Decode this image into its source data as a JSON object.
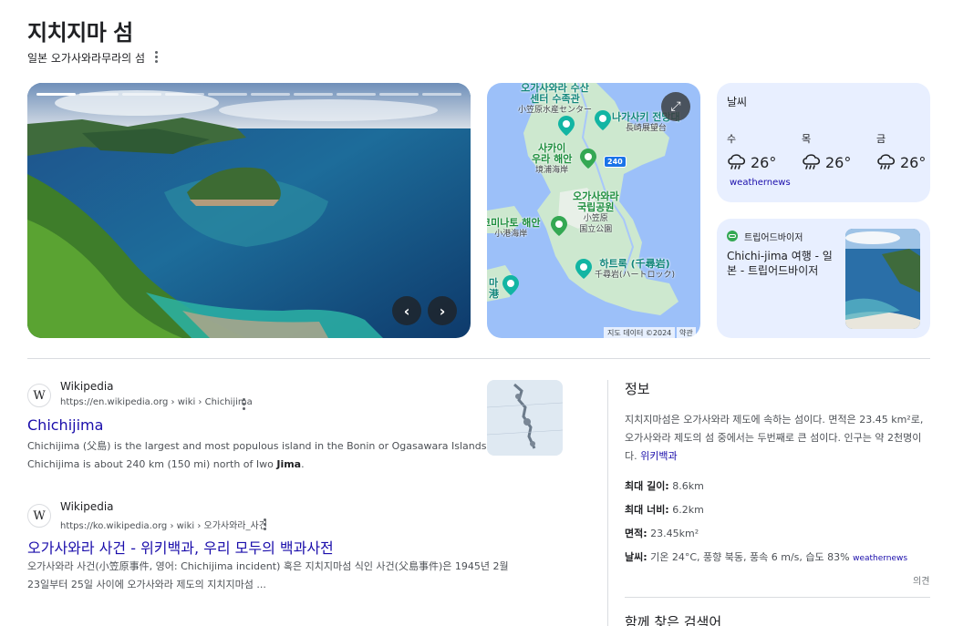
{
  "header": {
    "title": "지치지마 섬",
    "subtitle": "일본 오가사와라무라의 섬"
  },
  "photo": {
    "slides": 10,
    "active_slide": 1
  },
  "map": {
    "labels": {
      "aquarium": "오가사와라 수산\n센터 수족관",
      "aquarium_ja": "小笠原水産センター",
      "observatory": "나가사키 전망대",
      "observatory_ja": "長崎展望台",
      "beach": "사카이\n우라 해안",
      "beach_ja": "境浦海岸",
      "park": "오가사와라\n국립공원",
      "park_ja": "小笠原\n国立公園",
      "minato": "코미나토 해안",
      "minato_ja": "小港海岸",
      "heart_rock": "하트록 (千尋岩)",
      "heart_rock_ja": "千尋岩(ハートロック)",
      "south": "마\n港"
    },
    "route": "240",
    "credit": "지도 데이터 ©2024",
    "terms": "약관"
  },
  "weather": {
    "title": "날씨",
    "days": [
      {
        "day": "수",
        "temp": "26°",
        "icon": "rain-cloud-icon"
      },
      {
        "day": "목",
        "temp": "26°",
        "icon": "rain-cloud-icon"
      },
      {
        "day": "금",
        "temp": "26°",
        "icon": "rain-cloud-icon"
      }
    ],
    "source": "weathernews"
  },
  "tripadvisor": {
    "source": "트립어드바이저",
    "title": "Chichi-jima 여행 - 일본 - 트립어드바이저"
  },
  "results": [
    {
      "site": "Wikipedia",
      "url": "https://en.wikipedia.org › wiki › Chichijima",
      "title": "Chichijima",
      "snippet_a": "Chichijima (父島) is the largest and most populous island in the Bonin or Ogasawara Islands. Chichijima is about 240 km (150 mi) north of Iwo ",
      "snippet_b": "Jima",
      "snippet_c": "."
    },
    {
      "site": "Wikipedia",
      "url": "https://ko.wikipedia.org › wiki › 오가사와라_사건",
      "title": "오가사와라 사건 - 위키백과, 우리 모두의 백과사전",
      "snippet_a": "오가사와라 사건(小笠原事件, 영어: Chichijima incident) 혹은 지치지마섬 식인 사건(父島事件)은 1945년 2월 23일부터 25일 사이에 오가사와라 제도의 지치지마섬 ...",
      "snippet_b": "",
      "snippet_c": ""
    }
  ],
  "info": {
    "heading": "정보",
    "description": "지치지마섬은 오가사와라 제도에 속하는 섬이다. 면적은 23.45 km²로, 오가사와라 제도의 섬 중에서는 두번째로 큰 섬이다. 인구는 약 2천명이다. ",
    "description_link": "위키백과",
    "facts": [
      {
        "label": "최대 길이:",
        "value": " 8.6km"
      },
      {
        "label": "최대 너비:",
        "value": " 6.2km"
      },
      {
        "label": "면적:",
        "value": " 23.45km²"
      },
      {
        "label": "날씨:",
        "value": " 기온 24°C, 풍향 북동, 풍속 6 m/s, 습도 83% "
      }
    ],
    "weather_source": "weathernews",
    "feedback": "의견",
    "related_heading": "함께 찾은 검색어"
  },
  "colors": {
    "link": "#1a0dab",
    "card_bg": "#e8efff",
    "map_water": "#9cc0f9",
    "map_land": "#c8e6c9"
  }
}
